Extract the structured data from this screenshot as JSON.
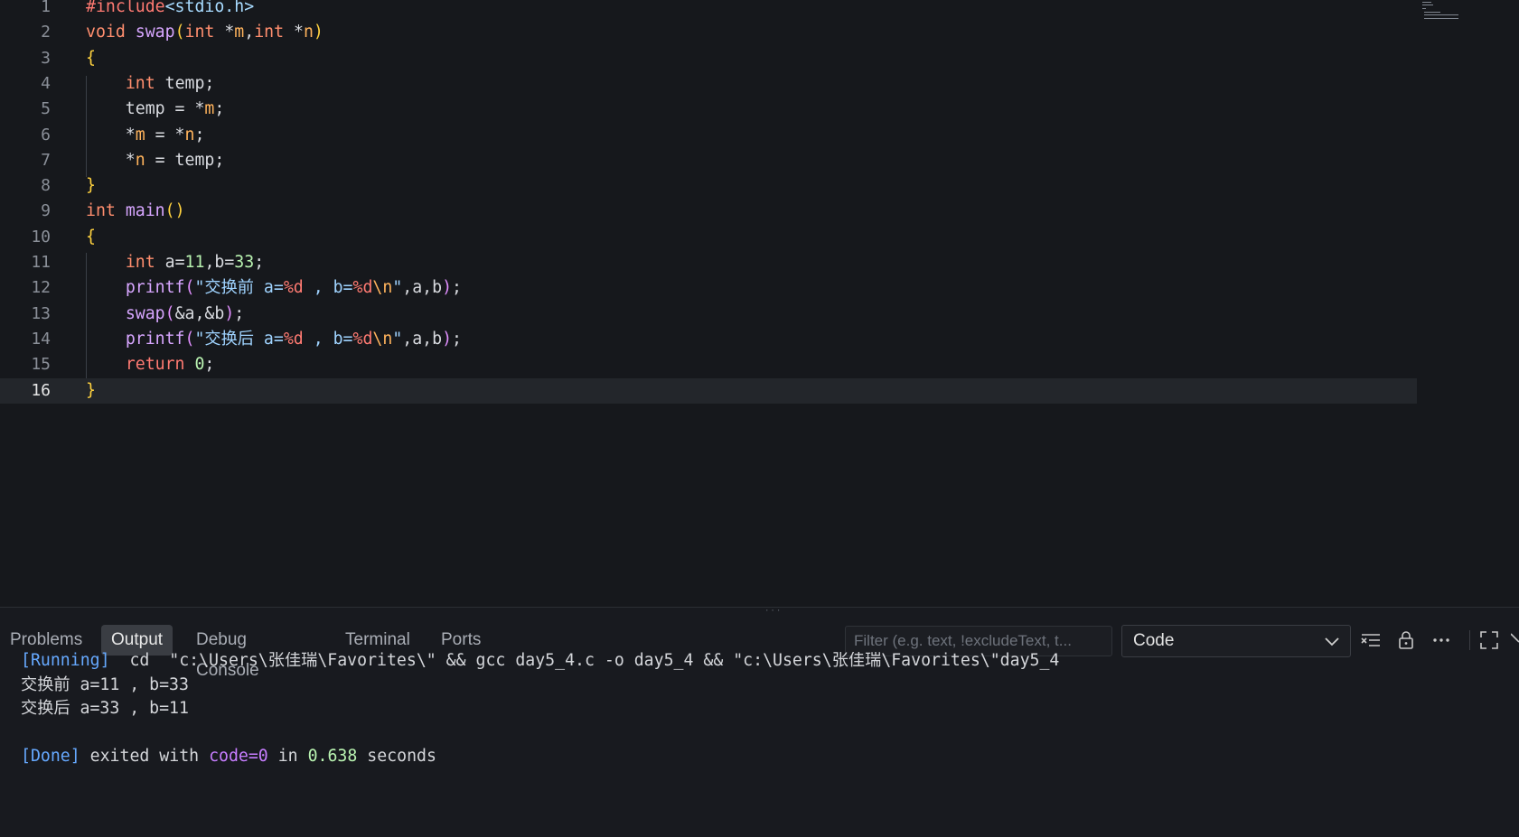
{
  "editor": {
    "active_line": 16,
    "lines": [
      {
        "n": "1",
        "segs": [
          [
            "t-inc",
            "#include"
          ],
          [
            "t-hdr",
            "<stdio.h>"
          ]
        ]
      },
      {
        "n": "2",
        "segs": [
          [
            "t-type",
            "void"
          ],
          [
            "t-op",
            " "
          ],
          [
            "t-fn",
            "swap"
          ],
          [
            "t-brace",
            "("
          ],
          [
            "t-type",
            "int"
          ],
          [
            "t-op",
            " *"
          ],
          [
            "t-var",
            "m"
          ],
          [
            "t-op",
            ","
          ],
          [
            "t-type",
            "int"
          ],
          [
            "t-op",
            " *"
          ],
          [
            "t-var",
            "n"
          ],
          [
            "t-brace",
            ")"
          ]
        ]
      },
      {
        "n": "3",
        "segs": [
          [
            "t-brace",
            "{"
          ]
        ]
      },
      {
        "n": "4",
        "segs": [
          [
            "t-op",
            "    "
          ],
          [
            "t-type",
            "int"
          ],
          [
            "t-op",
            " temp;"
          ]
        ]
      },
      {
        "n": "5",
        "segs": [
          [
            "t-op",
            "    temp = *"
          ],
          [
            "t-var",
            "m"
          ],
          [
            "t-op",
            ";"
          ]
        ]
      },
      {
        "n": "6",
        "segs": [
          [
            "t-op",
            "    *"
          ],
          [
            "t-var",
            "m"
          ],
          [
            "t-op",
            " = *"
          ],
          [
            "t-var",
            "n"
          ],
          [
            "t-op",
            ";"
          ]
        ]
      },
      {
        "n": "7",
        "segs": [
          [
            "t-op",
            "    *"
          ],
          [
            "t-var",
            "n"
          ],
          [
            "t-op",
            " = temp;"
          ]
        ]
      },
      {
        "n": "8",
        "segs": [
          [
            "t-brace",
            "}"
          ]
        ]
      },
      {
        "n": "9",
        "segs": [
          [
            "t-type",
            "int"
          ],
          [
            "t-op",
            " "
          ],
          [
            "t-fn",
            "main"
          ],
          [
            "t-brace",
            "()"
          ]
        ]
      },
      {
        "n": "10",
        "segs": [
          [
            "t-brace",
            "{"
          ]
        ]
      },
      {
        "n": "11",
        "segs": [
          [
            "t-op",
            "    "
          ],
          [
            "t-type",
            "int"
          ],
          [
            "t-op",
            " a="
          ],
          [
            "t-num",
            "11"
          ],
          [
            "t-op",
            ",b="
          ],
          [
            "t-num",
            "33"
          ],
          [
            "t-op",
            ";"
          ]
        ]
      },
      {
        "n": "12",
        "segs": [
          [
            "t-op",
            "    "
          ],
          [
            "t-fn",
            "printf"
          ],
          [
            "t-brace2",
            "("
          ],
          [
            "t-str",
            "\"交换前 a="
          ],
          [
            "t-fmt",
            "%d"
          ],
          [
            "t-str",
            " , b="
          ],
          [
            "t-fmt",
            "%d"
          ],
          [
            "t-esc",
            "\\n"
          ],
          [
            "t-str",
            "\""
          ],
          [
            "t-op",
            ",a,b"
          ],
          [
            "t-brace2",
            ")"
          ],
          [
            "t-op",
            ";"
          ]
        ]
      },
      {
        "n": "13",
        "segs": [
          [
            "t-op",
            "    "
          ],
          [
            "t-fn",
            "swap"
          ],
          [
            "t-brace2",
            "("
          ],
          [
            "t-op",
            "&a,&b"
          ],
          [
            "t-brace2",
            ")"
          ],
          [
            "t-op",
            ";"
          ]
        ]
      },
      {
        "n": "14",
        "segs": [
          [
            "t-op",
            "    "
          ],
          [
            "t-fn",
            "printf"
          ],
          [
            "t-brace2",
            "("
          ],
          [
            "t-str",
            "\"交换后 a="
          ],
          [
            "t-fmt",
            "%d"
          ],
          [
            "t-str",
            " , b="
          ],
          [
            "t-fmt",
            "%d"
          ],
          [
            "t-esc",
            "\\n"
          ],
          [
            "t-str",
            "\""
          ],
          [
            "t-op",
            ",a,b"
          ],
          [
            "t-brace2",
            ")"
          ],
          [
            "t-op",
            ";"
          ]
        ]
      },
      {
        "n": "15",
        "segs": [
          [
            "t-op",
            "    "
          ],
          [
            "t-kw",
            "return"
          ],
          [
            "t-op",
            " "
          ],
          [
            "t-num",
            "0"
          ],
          [
            "t-op",
            ";"
          ]
        ]
      },
      {
        "n": "16",
        "segs": [
          [
            "t-brace",
            "}"
          ]
        ]
      }
    ]
  },
  "panel": {
    "tabs": [
      {
        "label": "Problems",
        "active": false
      },
      {
        "label": "Output",
        "active": true
      },
      {
        "label": "Debug Console",
        "active": false
      },
      {
        "label": "Terminal",
        "active": false
      },
      {
        "label": "Ports",
        "active": false
      }
    ],
    "filter_placeholder": "Filter (e.g. text, !excludeText, t...",
    "channel": "Code",
    "icons": [
      "clear-output-icon",
      "lock-icon",
      "more-actions-icon",
      "maximize-icon",
      "close-icon"
    ]
  },
  "output": {
    "lines": [
      [
        [
          "o-blue",
          "[Running]"
        ],
        [
          "",
          "  cd  \"c:\\Users\\张佳瑞\\Favorites\\\" && gcc day5_4.c -o day5_4 && \"c:\\Users\\张佳瑞\\Favorites\\\"day5_4"
        ]
      ],
      [
        [
          "",
          "交换前 a=11 , b=33"
        ]
      ],
      [
        [
          "",
          "交换后 a=33 , b=11"
        ]
      ],
      [
        [
          "",
          ""
        ]
      ],
      [
        [
          "o-blue",
          "[Done]"
        ],
        [
          "",
          " exited with "
        ],
        [
          "o-purple",
          "code=0"
        ],
        [
          "",
          " in "
        ],
        [
          "o-green",
          "0.638"
        ],
        [
          "",
          " seconds"
        ]
      ]
    ]
  }
}
